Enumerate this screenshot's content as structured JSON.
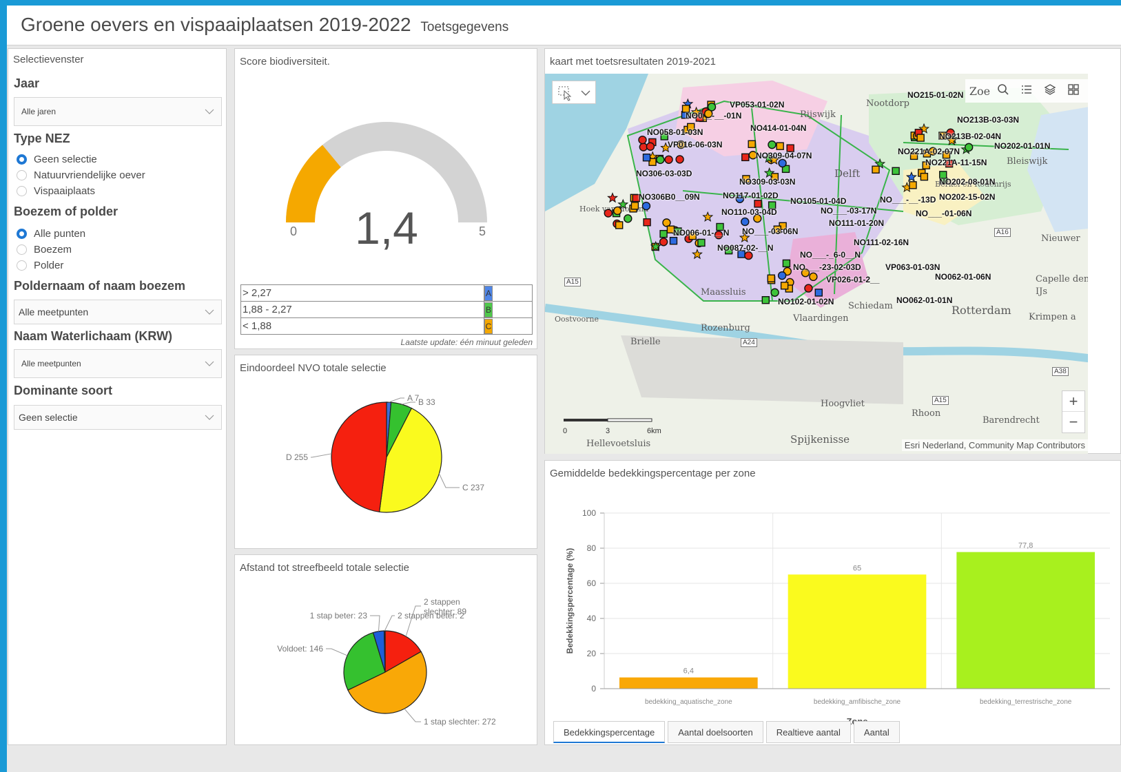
{
  "header": {
    "title": "Groene oevers en vispaaiplaatsen 2019-2022",
    "subtitle": "Toetsgegevens"
  },
  "selection": {
    "title": "Selectievenster",
    "jaar": {
      "label": "Jaar",
      "value": "Alle jaren"
    },
    "type_nez": {
      "label": "Type NEZ",
      "options": [
        "Geen selectie",
        "Natuurvriendelijke oever",
        "Vispaaiplaats"
      ],
      "selected": 0
    },
    "boezem_polder": {
      "label": "Boezem of polder",
      "options": [
        "Alle punten",
        "Boezem",
        "Polder"
      ],
      "selected": 0
    },
    "poldernaam": {
      "label": "Poldernaam of naam boezem",
      "value": "Alle meetpunten"
    },
    "waterlichaam": {
      "label": "Naam Waterlichaam (KRW)",
      "value": "Alle meetpunten"
    },
    "dominante_soort": {
      "label": "Dominante soort",
      "value": "Geen selectie"
    }
  },
  "gauge": {
    "title": "Score biodiversiteit.",
    "value": "1,4",
    "min": "0",
    "max": "5",
    "fraction": 0.28,
    "legend": [
      {
        "range": "> 2,27",
        "code": "A",
        "color": "#4f86e8"
      },
      {
        "range": "1,88 - 2,27",
        "code": "B",
        "color": "#4fc94a"
      },
      {
        "range": "< 1,88",
        "code": "C",
        "color": "#f5a800"
      }
    ],
    "update": "Laatste update: één minuut geleden"
  },
  "pie1_title": "Eindoordeel NVO totale selectie",
  "pie2_title": "Afstand tot streefbeeld totale selectie",
  "map": {
    "title": "kaart met toetsresultaten 2019-2021",
    "search_text": "Zoe",
    "attribution": "Esri Nederland, Community Map Contributors",
    "scale": {
      "zero": "0",
      "mid": "3",
      "end": "6km"
    },
    "zoom_in": "+",
    "zoom_out": "−",
    "places": [
      "Hoek van Holland",
      "Maassluis",
      "Rozenburg",
      "Brielle",
      "Oostvoorne",
      "Hoogvliet",
      "Rhoon",
      "Barendrecht",
      "Spijkenisse",
      "Hellevoetsluis",
      "Rotterdam",
      "Schiedam",
      "Vlaardingen",
      "Delft",
      "Bleiswijk",
      "Nieuwer",
      "Capelle den IJs",
      "Krimpen a",
      "Rijswijk",
      "Nootdorp",
      "Berkel en Rodenrijs"
    ],
    "roads": [
      "A15",
      "A16",
      "A24",
      "A38",
      "A15"
    ],
    "sites": [
      "VP053-01-02N",
      "NO0__-__-01N",
      "NO058-01-03N",
      "VP016-06-03N",
      "NO414-01-04N",
      "NO215-01-02N",
      "NO213B-03-03N",
      "NO213B-02-04N",
      "NO221A-02-07N",
      "NO202-01-01N",
      "NO221A-11-15N",
      "NO306-03-03D",
      "NO309-04-07N",
      "NO309-03-03N",
      "NO306B0__09N",
      "NO117-01-02D",
      "NO105-01-04D",
      "NO110-03-04D",
      "NO202-08-01N",
      "NO202-15-02N",
      "NO___-__-13D",
      "NO___-03-17N",
      "NO___-01-06N",
      "NO111-01-20N",
      "NO006-01-__N",
      "NO___-03-06N",
      "NO111-02-16N",
      "NO087-02-__N",
      "NO___-_6-0__N",
      "NO___-23-02-03D",
      "VP063-01-03N",
      "NO062-01-06N",
      "VP026-01-2__",
      "NO102-01-02N",
      "NO062-01-01N"
    ]
  },
  "bar": {
    "title": "Gemiddelde bedekkingspercentage per zone",
    "tabs": [
      "Bedekkingspercentage",
      "Aantal doelsoorten",
      "Realtieve aantal",
      "Aantal"
    ],
    "active_tab": 0
  },
  "colors": {
    "accent": "#1e78d4",
    "frame": "#1a9ad6"
  },
  "chart_data": [
    {
      "type": "gauge",
      "title": "Score biodiversiteit.",
      "value": 1.4,
      "min": 0,
      "max": 5
    },
    {
      "type": "pie",
      "title": "Eindoordeel NVO totale selectie",
      "slices": [
        {
          "label": "A",
          "value": 7,
          "color": "#3b6fd8",
          "text": "A 7"
        },
        {
          "label": "B",
          "value": 33,
          "color": "#35c12f",
          "text": "B 33"
        },
        {
          "label": "C",
          "value": 237,
          "color": "#fafa1e",
          "text": "C 237"
        },
        {
          "label": "D",
          "value": 255,
          "color": "#f5200f",
          "text": "D 255"
        }
      ]
    },
    {
      "type": "pie",
      "title": "Afstand tot streefbeeld totale selectie",
      "slices": [
        {
          "label": "2 stappen slechter",
          "value": 89,
          "color": "#f5200f",
          "text": "2 stappen slechter: 89"
        },
        {
          "label": "1 stap slechter",
          "value": 272,
          "color": "#f9a807",
          "text": "1 stap slechter: 272"
        },
        {
          "label": "Voldoet",
          "value": 146,
          "color": "#35c12f",
          "text": "Voldoet: 146"
        },
        {
          "label": "1 stap beter",
          "value": 23,
          "color": "#1e5ed8",
          "text": "1 stap beter: 23"
        },
        {
          "label": "2 stappen beter",
          "value": 2,
          "color": "#1e5ed8",
          "text": "2 stappen beter: 2"
        }
      ]
    },
    {
      "type": "bar",
      "title": "Gemiddelde bedekkingspercentage per zone",
      "categories": [
        "bedekking_aquatische_zone",
        "bedekking_amfibische_zone",
        "bedekking_terrestrische_zone"
      ],
      "values": [
        6.4,
        65,
        77.8
      ],
      "value_labels": [
        "6,4",
        "65",
        "77,8"
      ],
      "colors": [
        "#f9a807",
        "#fafa1e",
        "#a8f01e"
      ],
      "xlabel": "Zone",
      "ylabel": "Bedekkingspercentage (%)",
      "ylim": [
        0,
        100
      ],
      "yticks": [
        0,
        20,
        40,
        60,
        80,
        100
      ]
    }
  ]
}
